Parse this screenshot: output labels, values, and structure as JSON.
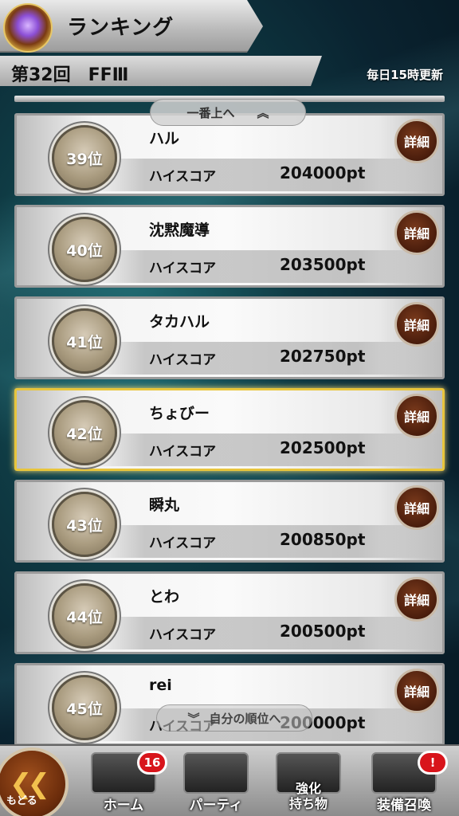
{
  "header": {
    "title": "ランキング"
  },
  "event": {
    "title": "第32回　FFⅢ",
    "update": "毎日15時更新"
  },
  "list": {
    "scroll_top_label": "一番上へ",
    "scroll_top_icon": "double-chevron-up-icon",
    "scroll_self_label": "自分の順位へ",
    "scroll_self_icon": "double-chevron-down-icon",
    "detail_label": "詳細",
    "score_label": "ハイスコア",
    "rows": [
      {
        "rank": "39位",
        "name": "ハル",
        "score": "204000pt"
      },
      {
        "rank": "40位",
        "name": "沈黙魔導",
        "score": "203500pt"
      },
      {
        "rank": "41位",
        "name": "タカハル",
        "score": "202750pt"
      },
      {
        "rank": "42位",
        "name": "ちょびー",
        "score": "202500pt",
        "highlight": true
      },
      {
        "rank": "43位",
        "name": "瞬丸",
        "score": "200850pt"
      },
      {
        "rank": "44位",
        "name": "とわ",
        "score": "200500pt"
      },
      {
        "rank": "45位",
        "name": "rei",
        "score": "200000pt"
      }
    ]
  },
  "nav": {
    "back_label": "もどる",
    "back_icon": "double-chevron-left-icon",
    "items": [
      {
        "label": "ホーム",
        "badge": "16"
      },
      {
        "label": "パーティ"
      },
      {
        "label": "強化\n持ち物"
      },
      {
        "label": "装備召喚",
        "badge": "!"
      }
    ]
  },
  "colors": {
    "highlight_border": "#e8c53c",
    "detail_button": "#4a1d0c",
    "badge_red": "#d8141b"
  }
}
